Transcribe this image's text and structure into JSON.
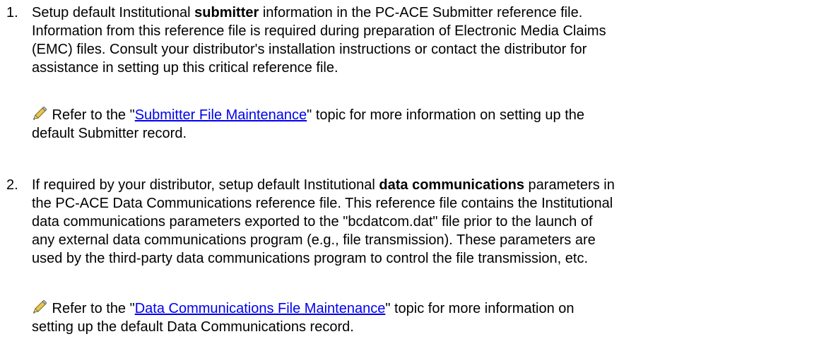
{
  "items": [
    {
      "number": "1.",
      "line1_pre": "Setup default Institutional ",
      "line1_bold": "submitter",
      "line1_post": " information in the PC-ACE Submitter reference file.",
      "line2": "Information from this reference file is required during preparation of Electronic Media Claims",
      "line3": "(EMC) files. Consult your distributor's installation instructions or contact the distributor for",
      "line4": "assistance in setting up this critical reference file.",
      "note": {
        "icon": "pencil-icon",
        "pre": " Refer to the \"",
        "link": "Submitter File Maintenance",
        "post": "\" topic for more information on setting up the",
        "line2": "default Submitter record."
      }
    },
    {
      "number": "2.",
      "line1_pre": "If required by your distributor, setup default Institutional ",
      "line1_bold": "data communications",
      "line1_post": " parameters in",
      "line2": "the PC-ACE Data Communications reference file. This reference file contains the Institutional",
      "line3": "data communications parameters exported to the \"bcdatcom.dat\" file prior to the launch of",
      "line4": "any external data communications program (e.g., file transmission). These parameters are",
      "line5": "used by the third-party data communications program to control the file transmission, etc.",
      "note": {
        "icon": "pencil-icon",
        "pre": " Refer to the \"",
        "link": "Data Communications File Maintenance",
        "post": "\" topic for more information on",
        "line2": "setting up the default Data Communications record."
      }
    }
  ],
  "colors": {
    "text": "#000000",
    "link": "#0000ee",
    "background": "#ffffff"
  }
}
